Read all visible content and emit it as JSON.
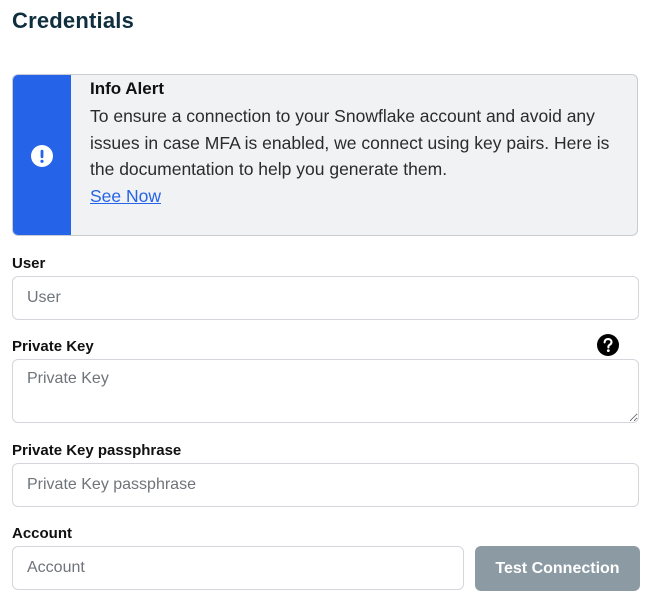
{
  "page": {
    "title": "Credentials"
  },
  "alert": {
    "title": "Info Alert",
    "message": "To ensure a connection to your Snowflake account and avoid any issues in case MFA is enabled, we connect using key pairs. Here is the documentation to help you generate them.",
    "link_label": "See Now",
    "icon": "exclamation-circle-icon",
    "accent_color": "#2563e8"
  },
  "form": {
    "user": {
      "label": "User",
      "placeholder": "User",
      "value": ""
    },
    "private_key": {
      "label": "Private Key",
      "placeholder": "Private Key",
      "value": "",
      "help_icon": "question-circle-icon"
    },
    "passphrase": {
      "label": "Private Key passphrase",
      "placeholder": "Private Key passphrase",
      "value": ""
    },
    "account": {
      "label": "Account",
      "placeholder": "Account",
      "value": ""
    },
    "test_button_label": "Test Connection",
    "test_button_color": "#8c9aa4"
  }
}
